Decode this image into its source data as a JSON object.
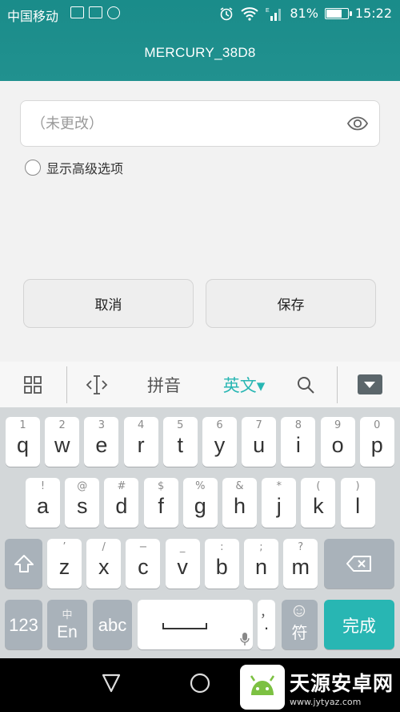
{
  "status_bar": {
    "carrier": "中国移动",
    "battery_text": "81%",
    "battery_level": 0.81,
    "time": "15:22"
  },
  "header": {
    "title": "MERCURY_38D8"
  },
  "form": {
    "password_placeholder": "（未更改）",
    "advanced_label": "显示高级选项",
    "cancel_label": "取消",
    "save_label": "保存"
  },
  "ime_toolbar": {
    "pinyin_label": "拼音",
    "english_label": "英文▾"
  },
  "keyboard": {
    "row1": [
      {
        "hint": "1",
        "ch": "q"
      },
      {
        "hint": "2",
        "ch": "w"
      },
      {
        "hint": "3",
        "ch": "e"
      },
      {
        "hint": "4",
        "ch": "r"
      },
      {
        "hint": "5",
        "ch": "t"
      },
      {
        "hint": "6",
        "ch": "y"
      },
      {
        "hint": "7",
        "ch": "u"
      },
      {
        "hint": "8",
        "ch": "i"
      },
      {
        "hint": "9",
        "ch": "o"
      },
      {
        "hint": "0",
        "ch": "p"
      }
    ],
    "row2": [
      {
        "hint": "!",
        "ch": "a"
      },
      {
        "hint": "@",
        "ch": "s"
      },
      {
        "hint": "#",
        "ch": "d"
      },
      {
        "hint": "$",
        "ch": "f"
      },
      {
        "hint": "%",
        "ch": "g"
      },
      {
        "hint": "&",
        "ch": "h"
      },
      {
        "hint": "*",
        "ch": "j"
      },
      {
        "hint": "(",
        "ch": "k"
      },
      {
        "hint": ")",
        "ch": "l"
      }
    ],
    "row3": [
      {
        "hint": "’",
        "ch": "z"
      },
      {
        "hint": "/",
        "ch": "x"
      },
      {
        "hint": "−",
        "ch": "c"
      },
      {
        "hint": "_",
        "ch": "v"
      },
      {
        "hint": ":",
        "ch": "b"
      },
      {
        "hint": ";",
        "ch": "n"
      },
      {
        "hint": "?",
        "ch": "m"
      }
    ],
    "num_label": "123",
    "lang_hint": "中",
    "lang_label": "En",
    "abc_label": "abc",
    "comma_label": "，",
    "period_label": "·",
    "symbol_label": "符",
    "done_label": "完成"
  },
  "watermark": {
    "name": "天源安卓网",
    "url": "www.jytyaz.com"
  }
}
